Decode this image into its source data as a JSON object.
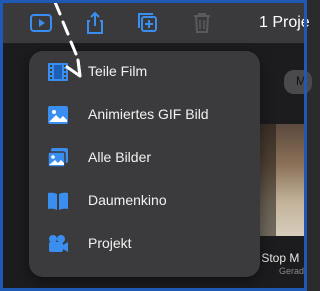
{
  "toolbar": {
    "project_title": "1 Proje",
    "buttons": [
      {
        "name": "play-icon"
      },
      {
        "name": "share-icon"
      },
      {
        "name": "add-clip-icon"
      },
      {
        "name": "trash-icon"
      }
    ]
  },
  "share_menu": {
    "items": [
      {
        "icon": "film-icon",
        "label": "Teile Film"
      },
      {
        "icon": "image-icon",
        "label": "Animiertes GIF Bild"
      },
      {
        "icon": "images-icon",
        "label": "Alle Bilder"
      },
      {
        "icon": "book-icon",
        "label": "Daumenkino"
      },
      {
        "icon": "movie-camera-icon",
        "label": "Projekt"
      }
    ]
  },
  "background": {
    "pill_text": "M",
    "caption": "y Stop M",
    "subcaption": "Gerad"
  },
  "colors": {
    "accent": "#3a8ef0",
    "menu_bg": "#3b3b3d",
    "toolbar_bg": "#3a3a3d"
  }
}
